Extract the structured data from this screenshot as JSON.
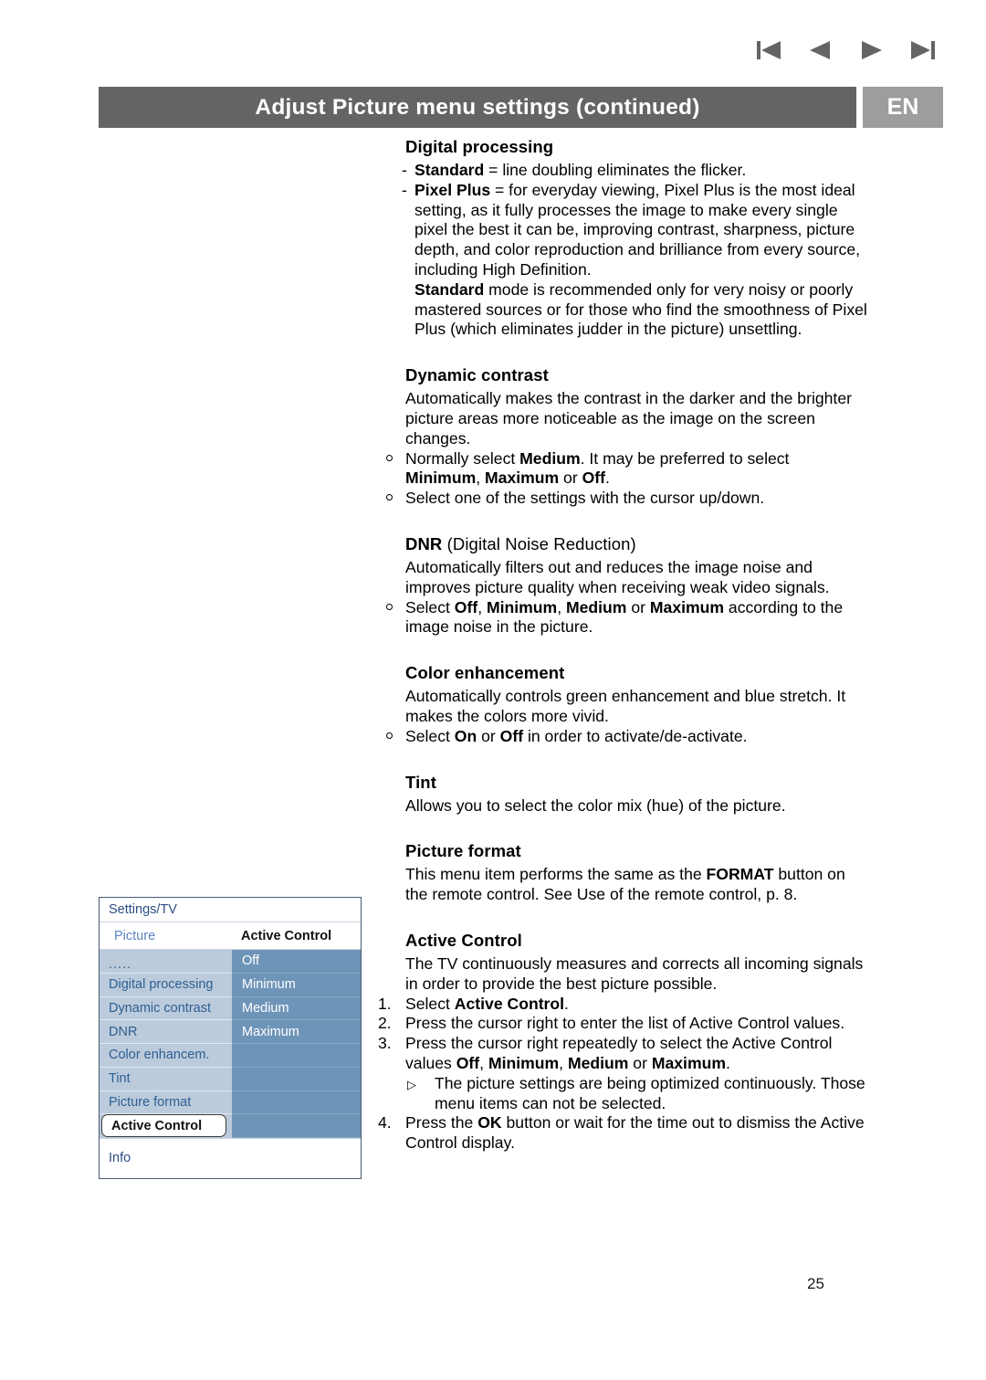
{
  "nav": {
    "first_label": "first-page",
    "prev_label": "previous-page",
    "next_label": "next-page",
    "last_label": "last-page"
  },
  "header": {
    "title": "Adjust Picture menu settings (continued)",
    "language": "EN",
    "bar_color": "#646464",
    "badge_color": "#9d9d9d"
  },
  "sections": {
    "digital_processing": {
      "heading": "Digital processing",
      "items": [
        {
          "dash": "-",
          "term": "Standard",
          "rest": " = line doubling eliminates the flicker."
        },
        {
          "dash": "-",
          "term": "Pixel Plus",
          "rest": " = for everyday viewing, Pixel Plus is the most ideal setting, as it fully processes the image to make every single pixel the best it can be, improving contrast, sharpness, picture depth, and color reproduction and brilliance from every source, including High Definition.",
          "term2": "Standard",
          "rest2": " mode is recommended only for very noisy or poorly mastered sources or for those who find the smoothness of Pixel Plus (which eliminates judder in the picture) unsettling."
        }
      ]
    },
    "dynamic_contrast": {
      "heading": "Dynamic contrast",
      "paragraph": "Automatically makes the contrast in the darker and the brighter picture areas more noticeable as the image on the screen changes.",
      "bullets": [
        {
          "pre": "Normally select ",
          "b1": "Medium",
          "mid": ". It may be preferred to select ",
          "b2": "Minimum",
          "sep1": ", ",
          "b3": "Maximum",
          "sep2": " or ",
          "b4": "Off",
          "post": "."
        },
        {
          "plain": "Select one of the settings with the cursor up/down."
        }
      ]
    },
    "dnr": {
      "heading_bold": "DNR",
      "heading_rest": " (Digital Noise Reduction)",
      "paragraph": "Automatically filters out and reduces the image noise and improves picture quality when receiving weak video signals.",
      "bullet": {
        "pre": "Select ",
        "b1": "Off",
        "sep1": ", ",
        "b2": "Minimum",
        "sep2": ", ",
        "b3": "Medium",
        "sep3": " or ",
        "b4": "Maximum",
        "post": " according to the image noise in the picture."
      }
    },
    "color_enhancement": {
      "heading": "Color enhancement",
      "paragraph": "Automatically controls green enhancement and blue stretch. It makes the colors more vivid.",
      "bullet": {
        "pre": "Select ",
        "b1": "On",
        "sep1": " or ",
        "b2": "Off",
        "post": " in order to activate/de-activate."
      }
    },
    "tint": {
      "heading": "Tint",
      "paragraph": "Allows you to select the color mix (hue) of the picture."
    },
    "picture_format": {
      "heading": "Picture format",
      "pre": "This menu item performs the same as the ",
      "bold": "FORMAT",
      "post": " button on the remote control. See Use of the remote control, p. 8."
    },
    "active_control": {
      "heading": "Active Control",
      "paragraph": "The TV continuously measures and corrects all incoming signals in order to provide the best picture possible.",
      "steps": [
        {
          "num": "1.",
          "pre": "Select ",
          "bold": "Active Control",
          "post": "."
        },
        {
          "num": "2.",
          "plain": "Press the cursor right to enter the list of Active Control values."
        },
        {
          "num": "3.",
          "pre": "Press the cursor right repeatedly to select the Active Control values ",
          "b1": "Off",
          "sep1": ", ",
          "b2": "Minimum",
          "sep2": ", ",
          "b3": "Medium",
          "sep3": " or ",
          "b4": "Maximum",
          "post": "."
        },
        {
          "num": "4.",
          "pre": "Press the ",
          "bold": "OK",
          "post": " button or wait for the time out to dismiss the Active Control display."
        }
      ],
      "sub_note": {
        "marker": "▷",
        "text": "The picture settings are being optimized continuously. Those menu items can not be selected."
      }
    }
  },
  "tv_menu": {
    "breadcrumb": "Settings/TV",
    "category": "Picture",
    "value_header": "Active Control",
    "left_items": [
      ".....",
      "Digital processing",
      "Dynamic contrast",
      "DNR",
      "Color enhancem.",
      "Tint",
      "Picture format"
    ],
    "selected_item": "Active Control",
    "right_values": [
      "Off",
      "Minimum",
      "Medium",
      "Maximum"
    ],
    "footer": "Info",
    "colors": {
      "left_bg": "#bccbdc",
      "right_bg": "#6e95b8",
      "link_blue": "#2d5f91",
      "breadcrumb_blue": "#2d4d86"
    }
  },
  "page_number": "25"
}
